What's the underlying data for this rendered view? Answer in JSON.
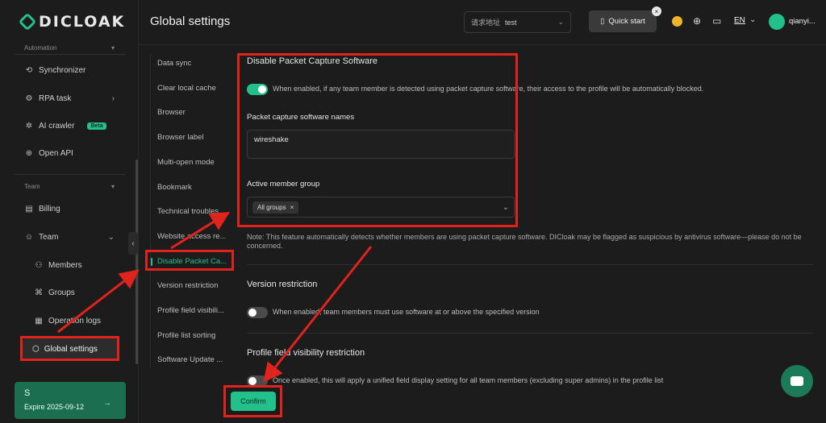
{
  "app": {
    "logo_text": "DICLOAK"
  },
  "sidebar": {
    "automation_header": "Automation",
    "team_header": "Team",
    "items": {
      "synchronizer": "Synchronizer",
      "rpa_task": "RPA task",
      "ai_crawler": "AI crawler",
      "beta": "Beta",
      "open_api": "Open API",
      "billing": "Billing",
      "team": "Team",
      "members": "Members",
      "groups": "Groups",
      "operation_logs": "Operation logs",
      "global_settings": "Global settings"
    },
    "plan": {
      "letter": "S",
      "expire": "Expire 2025-09-12"
    }
  },
  "header": {
    "title": "Global settings",
    "request_label": "请求地址",
    "request_value": "test",
    "quick_start": "Quick start",
    "lang": "EN",
    "username": "qianyi..."
  },
  "settings_nav": [
    "Data sync",
    "Clear local cache",
    "Browser",
    "Browser label",
    "Multi-open mode",
    "Bookmark",
    "Technical troubles...",
    "Website access re...",
    "Disable Packet Ca...",
    "Version restriction",
    "Profile field visibili...",
    "Profile list sorting",
    "Software Update ..."
  ],
  "packet": {
    "title": "Disable Packet Capture Software",
    "toggle_on": true,
    "desc": "When enabled, if any team member is detected using packet capture software, their access to the profile will be automatically blocked.",
    "names_label": "Packet capture software names",
    "names_value": "wireshake",
    "group_label": "Active member group",
    "group_tag": "All groups",
    "note": "Note: This feature automatically detects whether members are using packet capture software. DICloak may be flagged as suspicious by antivirus software—please do not be concerned."
  },
  "version": {
    "title": "Version restriction",
    "toggle_on": false,
    "desc": "When enabled, team members must use software at or above the specified version"
  },
  "profile_field": {
    "title": "Profile field visibility restriction",
    "toggle_on": false,
    "desc": "Once enabled, this will apply a unified field display setting for all team members (excluding super admins) in the profile list"
  },
  "confirm_label": "Confirm",
  "colors": {
    "accent": "#22c08a",
    "annotation": "#e0231c",
    "bg": "#1c1c1c"
  }
}
